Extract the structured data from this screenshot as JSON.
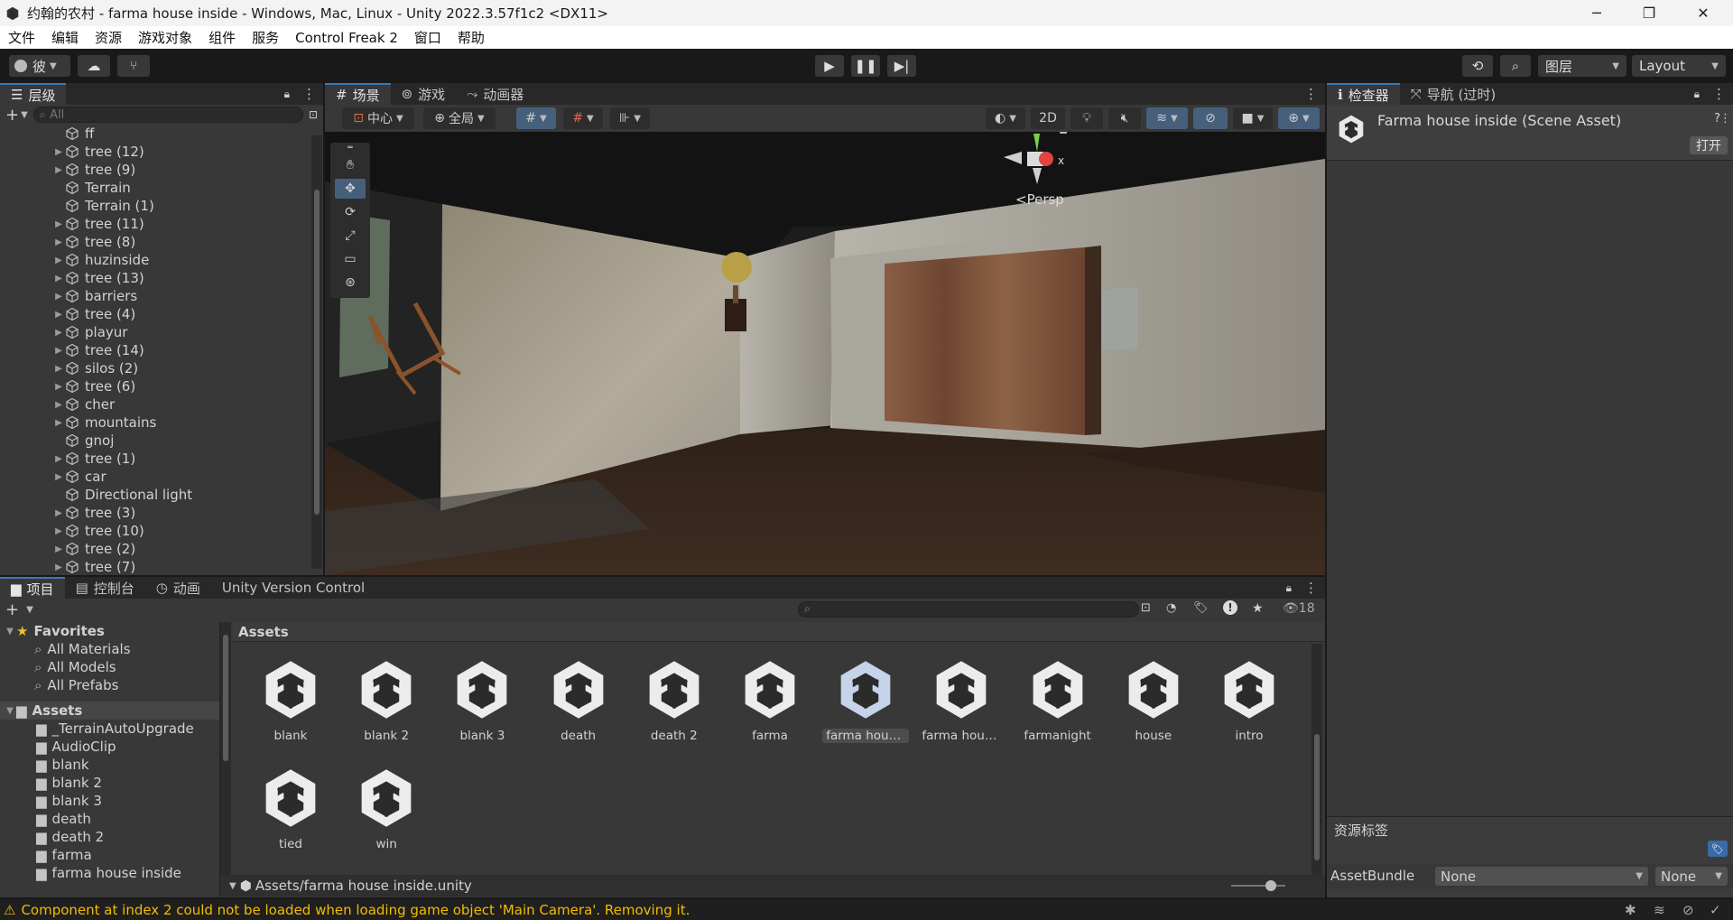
{
  "window": {
    "title": "约翰的农村 - farma house inside - Windows, Mac, Linux - Unity 2022.3.57f1c2 <DX11>",
    "min": "─",
    "max": "❐",
    "close": "✕"
  },
  "menu": [
    "文件",
    "编辑",
    "资源",
    "游戏对象",
    "组件",
    "服务",
    "Control Freak 2",
    "窗口",
    "帮助"
  ],
  "toolbar": {
    "account": "彼",
    "layers": "图层",
    "layout": "Layout"
  },
  "hierarchy": {
    "tab": "层级",
    "search_placeholder": "All",
    "items": [
      {
        "name": "ff",
        "arrow": false
      },
      {
        "name": "tree (12)",
        "arrow": true
      },
      {
        "name": "tree (9)",
        "arrow": true
      },
      {
        "name": "Terrain",
        "arrow": false
      },
      {
        "name": "Terrain (1)",
        "arrow": false
      },
      {
        "name": "tree (11)",
        "arrow": true
      },
      {
        "name": "tree (8)",
        "arrow": true
      },
      {
        "name": "huzinside",
        "arrow": true
      },
      {
        "name": "tree (13)",
        "arrow": true
      },
      {
        "name": "barriers",
        "arrow": true
      },
      {
        "name": "tree (4)",
        "arrow": true
      },
      {
        "name": "playur",
        "arrow": true
      },
      {
        "name": "tree (14)",
        "arrow": true
      },
      {
        "name": "silos (2)",
        "arrow": true
      },
      {
        "name": "tree (6)",
        "arrow": true
      },
      {
        "name": "cher",
        "arrow": true
      },
      {
        "name": "mountains",
        "arrow": true
      },
      {
        "name": "gnoj",
        "arrow": false
      },
      {
        "name": "tree (1)",
        "arrow": true
      },
      {
        "name": "car",
        "arrow": true
      },
      {
        "name": "Directional light",
        "arrow": false
      },
      {
        "name": "tree (3)",
        "arrow": true
      },
      {
        "name": "tree (10)",
        "arrow": true
      },
      {
        "name": "tree (2)",
        "arrow": true
      },
      {
        "name": "tree (7)",
        "arrow": true
      }
    ]
  },
  "scene": {
    "tabs": [
      "场景",
      "游戏",
      "动画器"
    ],
    "pivot": "中心",
    "space": "全局",
    "mode2d": "2D",
    "persp": "Persp",
    "gizmo_y": "y",
    "gizmo_x": "x"
  },
  "inspector": {
    "tabs": [
      "检查器",
      "导航 (过时)"
    ],
    "asset_title": "Farma house inside (Scene Asset)",
    "open": "打开",
    "labels_header": "资源标签",
    "assetbundle_label": "AssetBundle",
    "assetbundle_value": "None",
    "variant_value": "None"
  },
  "project": {
    "tabs": [
      "项目",
      "控制台",
      "动画",
      "Unity Version Control"
    ],
    "visible_count": "18",
    "favorites": {
      "label": "Favorites",
      "items": [
        "All Materials",
        "All Models",
        "All Prefabs"
      ]
    },
    "assets_root": "Assets",
    "folders": [
      "_TerrainAutoUpgrade",
      "AudioClip",
      "blank",
      "blank 2",
      "blank 3",
      "death",
      "death 2",
      "farma",
      "farma house inside"
    ],
    "breadcrumb": "Assets",
    "assets": [
      "blank",
      "blank 2",
      "blank 3",
      "death",
      "death 2",
      "farma",
      "farma hous...",
      "farma hous...",
      "farmanight",
      "house",
      "intro",
      "tied",
      "win"
    ],
    "selected_index": 6,
    "path": "Assets/farma house inside.unity"
  },
  "status": {
    "message": "Component at index 2 could not be loaded when loading game object 'Main Camera'. Removing it.",
    "warning_color": "#f4bc02"
  }
}
